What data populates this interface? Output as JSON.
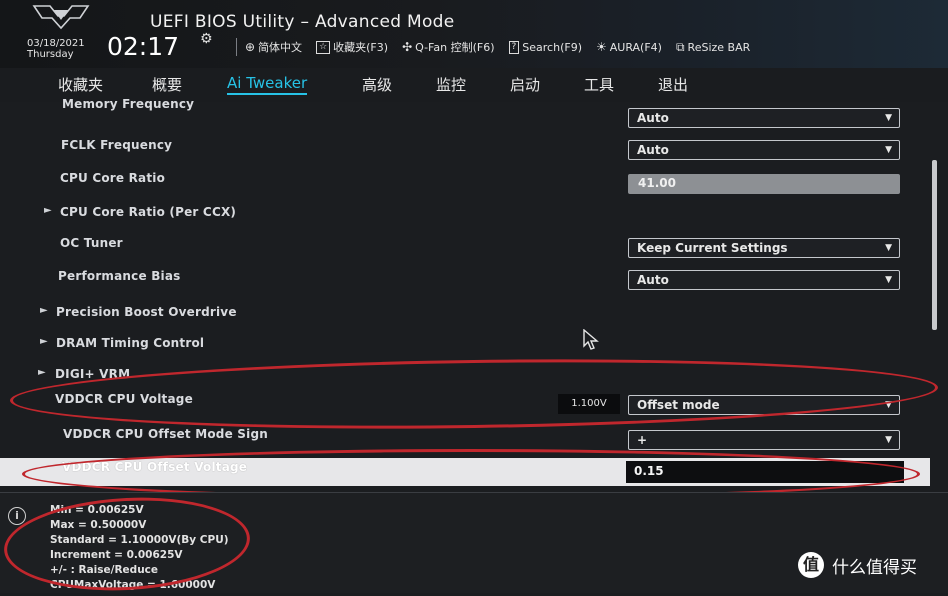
{
  "header": {
    "title": "UEFI BIOS Utility – Advanced Mode",
    "date": "03/18/2021",
    "weekday": "Thursday",
    "time": "02:17",
    "toolbar": [
      {
        "icon": "globe-icon",
        "label": "简体中文"
      },
      {
        "icon": "favorites-icon",
        "label": "收藏夹(F3)"
      },
      {
        "icon": "fan-icon",
        "label": "Q-Fan 控制(F6)"
      },
      {
        "icon": "search-help-icon",
        "label": "Search(F9)"
      },
      {
        "icon": "aura-icon",
        "label": "AURA(F4)"
      },
      {
        "icon": "resize-bar-icon",
        "label": "ReSize BAR"
      }
    ]
  },
  "tabs": [
    "收藏夹",
    "概要",
    "Ai Tweaker",
    "高级",
    "监控",
    "启动",
    "工具",
    "退出"
  ],
  "active_tab": "Ai Tweaker",
  "settings": {
    "memory_frequency": {
      "label": "Memory Frequency",
      "value": "Auto"
    },
    "fclk_frequency": {
      "label": "FCLK Frequency",
      "value": "Auto"
    },
    "cpu_core_ratio": {
      "label": "CPU Core Ratio",
      "value": "41.00"
    },
    "cpu_core_ratio_ccx": {
      "label": "CPU Core Ratio (Per CCX)"
    },
    "oc_tuner": {
      "label": "OC Tuner",
      "value": "Keep Current Settings"
    },
    "performance_bias": {
      "label": "Performance Bias",
      "value": "Auto"
    },
    "precision_boost": {
      "label": "Precision Boost Overdrive"
    },
    "dram_timing": {
      "label": "DRAM Timing Control"
    },
    "digi_vrm": {
      "label": "DIGI+ VRM"
    },
    "vddcr_cpu_voltage": {
      "label": "VDDCR CPU Voltage",
      "reading": "1.100V",
      "value": "Offset mode"
    },
    "vddcr_offset_sign": {
      "label": "VDDCR CPU Offset Mode Sign",
      "value": "+"
    },
    "vddcr_offset_voltage": {
      "label": "VDDCR CPU Offset Voltage",
      "value": "0.15"
    }
  },
  "help": {
    "lines": [
      "Min = 0.00625V",
      "Max = 0.50000V",
      "Standard = 1.10000V(By CPU)",
      "Increment = 0.00625V",
      "+/- : Raise/Reduce",
      "CPUMaxVoltage = 1.60000V"
    ]
  },
  "watermark": {
    "badge": "值",
    "text": "什么值得买"
  },
  "colors": {
    "accent": "#27c2e6",
    "annotation": "#c0272d",
    "highlight_row": "#e7e7e9"
  }
}
